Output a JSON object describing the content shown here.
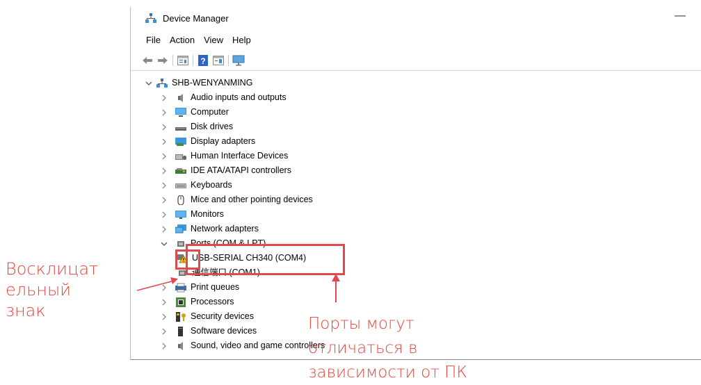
{
  "window": {
    "title": "Device Manager",
    "minimize_glyph": "—"
  },
  "menu": [
    "File",
    "Action",
    "View",
    "Help"
  ],
  "toolbar": [
    "back-icon",
    "forward-icon",
    "properties-icon",
    "help-icon",
    "update-driver-icon",
    "scan-hardware-icon"
  ],
  "tree": {
    "root": "SHB-WENYANMING",
    "categories": [
      {
        "label": "Audio inputs and outputs",
        "icon": "speaker-icon"
      },
      {
        "label": "Computer",
        "icon": "computer-icon"
      },
      {
        "label": "Disk drives",
        "icon": "disk-drive-icon"
      },
      {
        "label": "Display adapters",
        "icon": "display-adapter-icon"
      },
      {
        "label": "Human Interface Devices",
        "icon": "hid-icon"
      },
      {
        "label": "IDE ATA/ATAPI controllers",
        "icon": "ide-controller-icon"
      },
      {
        "label": "Keyboards",
        "icon": "keyboard-icon"
      },
      {
        "label": "Mice and other pointing devices",
        "icon": "mouse-icon"
      },
      {
        "label": "Monitors",
        "icon": "monitor-icon"
      },
      {
        "label": "Network adapters",
        "icon": "network-adapter-icon"
      },
      {
        "label": "Ports (COM & LPT)",
        "icon": "port-icon"
      },
      {
        "label": "USB-SERIAL CH340 (COM4)",
        "icon": "warning-device-icon"
      },
      {
        "label": "通信端口 (COM1)",
        "icon": "port-icon"
      },
      {
        "label": "Print queues",
        "icon": "printer-icon"
      },
      {
        "label": "Processors",
        "icon": "processor-icon"
      },
      {
        "label": "Security devices",
        "icon": "security-device-icon"
      },
      {
        "label": "Software devices",
        "icon": "software-device-icon"
      },
      {
        "label": "Sound, video and game controllers",
        "icon": "sound-icon"
      }
    ]
  },
  "annotations": {
    "left_label": [
      "Восклицат",
      "ельный",
      "знак"
    ],
    "right_label": [
      "Порты могут",
      "отличаться в",
      "зависимости от ПК"
    ]
  },
  "colors": {
    "annotation_red": "#e8453c",
    "box_red": "#e04a4a"
  }
}
